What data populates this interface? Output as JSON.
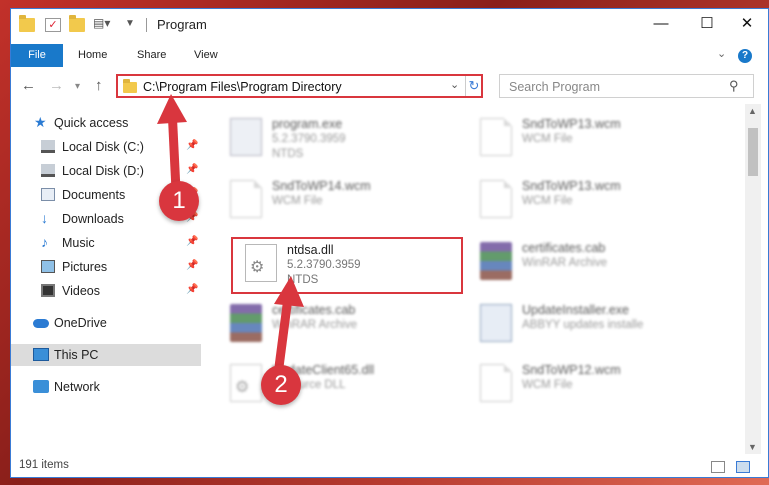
{
  "window": {
    "title": "Program"
  },
  "ribbon": {
    "file": "File",
    "tabs": [
      "Home",
      "Share",
      "View"
    ]
  },
  "address": {
    "path": "C:\\Program Files\\Program Directory"
  },
  "search": {
    "placeholder": "Search Program"
  },
  "nav": {
    "items": [
      {
        "label": "Quick access",
        "icon": "star-icon"
      },
      {
        "label": "Local Disk (C:)",
        "icon": "disk-icon",
        "pinned": true
      },
      {
        "label": "Local Disk (D:)",
        "icon": "disk-icon",
        "pinned": true
      },
      {
        "label": "Documents",
        "icon": "documents-icon",
        "pinned": true
      },
      {
        "label": "Downloads",
        "icon": "downloads-icon",
        "pinned": true
      },
      {
        "label": "Music",
        "icon": "music-icon",
        "pinned": true
      },
      {
        "label": "Pictures",
        "icon": "pictures-icon",
        "pinned": true
      },
      {
        "label": "Videos",
        "icon": "videos-icon",
        "pinned": true
      },
      {
        "label": "OneDrive",
        "icon": "onedrive-icon"
      },
      {
        "label": "This PC",
        "icon": "this-pc-icon",
        "selected": true
      },
      {
        "label": "Network",
        "icon": "network-icon"
      }
    ]
  },
  "files": [
    {
      "name": "program.exe",
      "l2": "5.2.3790.3959",
      "l3": "NTDS",
      "icon": "exe-icon"
    },
    {
      "name": "SndToWP13.wcm",
      "l2": "WCM File",
      "l3": "",
      "icon": "file-icon"
    },
    {
      "name": "SndToWP14.wcm",
      "l2": "WCM File",
      "l3": "",
      "icon": "file-icon"
    },
    {
      "name": "SndToWP13.wcm",
      "l2": "WCM File",
      "l3": "",
      "icon": "file-icon"
    },
    {
      "name": "ntdsa.dll",
      "l2": "5.2.3790.3959",
      "l3": "NTDS",
      "icon": "dll-gear-icon",
      "highlighted": true
    },
    {
      "name": "certificates.cab",
      "l2": "WinRAR Archive",
      "l3": "",
      "icon": "winrar-icon"
    },
    {
      "name": "certificates.cab",
      "l2": "WinRAR Archive",
      "l3": "",
      "icon": "winrar-icon"
    },
    {
      "name": "UpdateInstaller.exe",
      "l2": "ABBYY updates installe",
      "l3": "",
      "icon": "setup-icon"
    },
    {
      "name": "UpdateClient65.dll",
      "l2": "Resource DLL",
      "l3": "",
      "icon": "dll-gear-icon"
    },
    {
      "name": "SndToWP12.wcm",
      "l2": "WCM File",
      "l3": "",
      "icon": "file-icon"
    }
  ],
  "status": {
    "count": "191 items"
  },
  "callouts": {
    "one": "1",
    "two": "2"
  },
  "colors": {
    "accent": "#1979ca",
    "highlight": "#d9363e"
  }
}
